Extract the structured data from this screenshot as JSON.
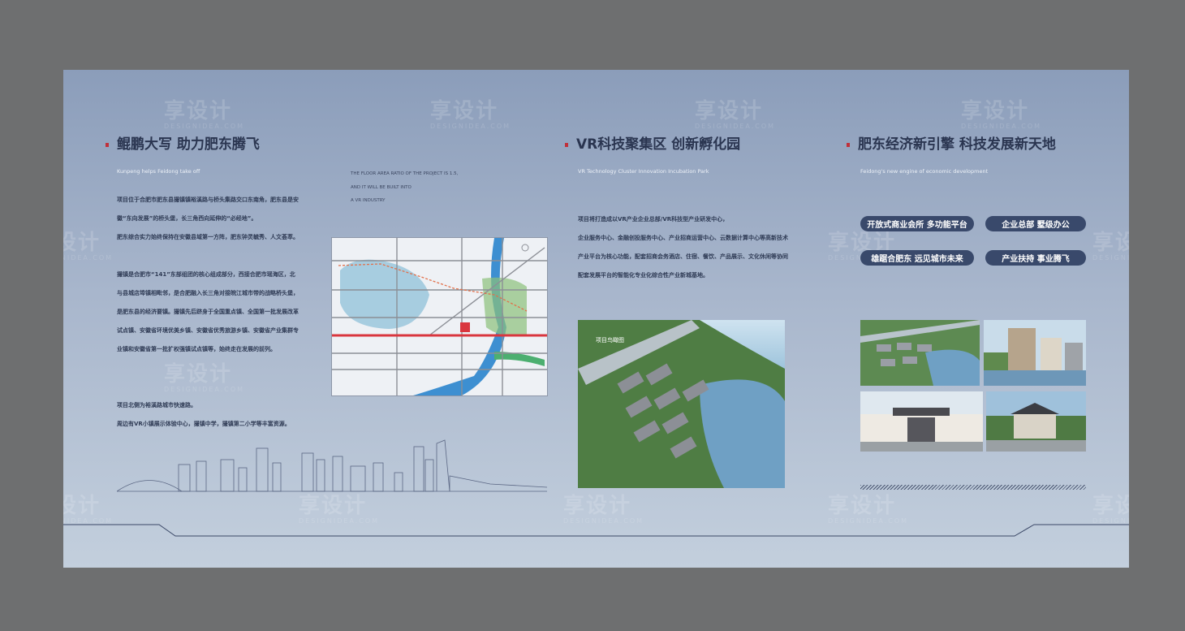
{
  "watermark": {
    "text": "享设计",
    "sub": "DESIGNIDEA.COM"
  },
  "col1": {
    "title": "鲲鹏大写 助力肥东腾飞",
    "subtitle": "Kunpeng helps Feidong take off",
    "paragraphs": [
      "项目位于合肥市肥东县撮镇镇裕溪路与桥头集路交口东南角，肥东县是安",
      "徽“东向发展”的桥头堡，长三角西向延伸的“必经地”。",
      "肥东综合实力始终保持在安徽县域第一方阵，肥东钟灵毓秀、人文荟萃。",
      "",
      "撮镇是合肥市“141”东部组团的核心组成部分，西接合肥市瑶海区，北",
      "与县城店埠镇相毗邻，是合肥融入长三角对接皖江城市带的战略桥头堡，",
      "是肥东县的经济要镇。撮镇先后跻身于全国重点镇、全国第一批发展改革",
      "试点镇、安徽省环境优美乡镇、安徽省优秀旅游乡镇、安徽省产业集群专",
      "业镇和安徽省第一批扩权强镇试点镇等，始终走在发展的前列。",
      "",
      "",
      "项目北侧为裕溪路城市快速路。",
      "周边有VR小镇展示体验中心，撮镇中学，撮镇第二小学等丰富资源。"
    ],
    "caption_lines": [
      "THE FLOOR AREA RATIO OF THE PROJECT IS 1.5,",
      "AND IT WILL BE BUILT INTO",
      "A VR INDUSTRY"
    ]
  },
  "col2": {
    "title": "VR科技聚集区 创新孵化园",
    "subtitle": "VR Technology Cluster Innovation Incubation Park",
    "paragraphs": [
      "项目将打造成以VR产业企业总部/VR科技型产业研发中心，",
      "企业服务中心、金融创投服务中心、产业招商运营中心、云数据计算中心等高新技术",
      "产业平台为核心功能，配套招商会务酒店、住宿、餐饮、产品展示、文化休闲等协同",
      "配套发展平台的智能化专业化综合性产业新城基地。"
    ],
    "photo_label": "项目鸟瞰图"
  },
  "col3": {
    "title": "肥东经济新引擎 科技发展新天地",
    "subtitle": "Feidong's new engine of economic development",
    "pills": [
      "开放式商业会所 多功能平台",
      "企业总部 墅级办公",
      "雄踞合肥东 远见城市未来",
      "产业扶持 事业腾飞"
    ]
  },
  "colors": {
    "accent": "#c0303a",
    "title": "#2a3550",
    "pill": "#39496b",
    "road": "#d9363e",
    "river": "#3d8fd1"
  }
}
